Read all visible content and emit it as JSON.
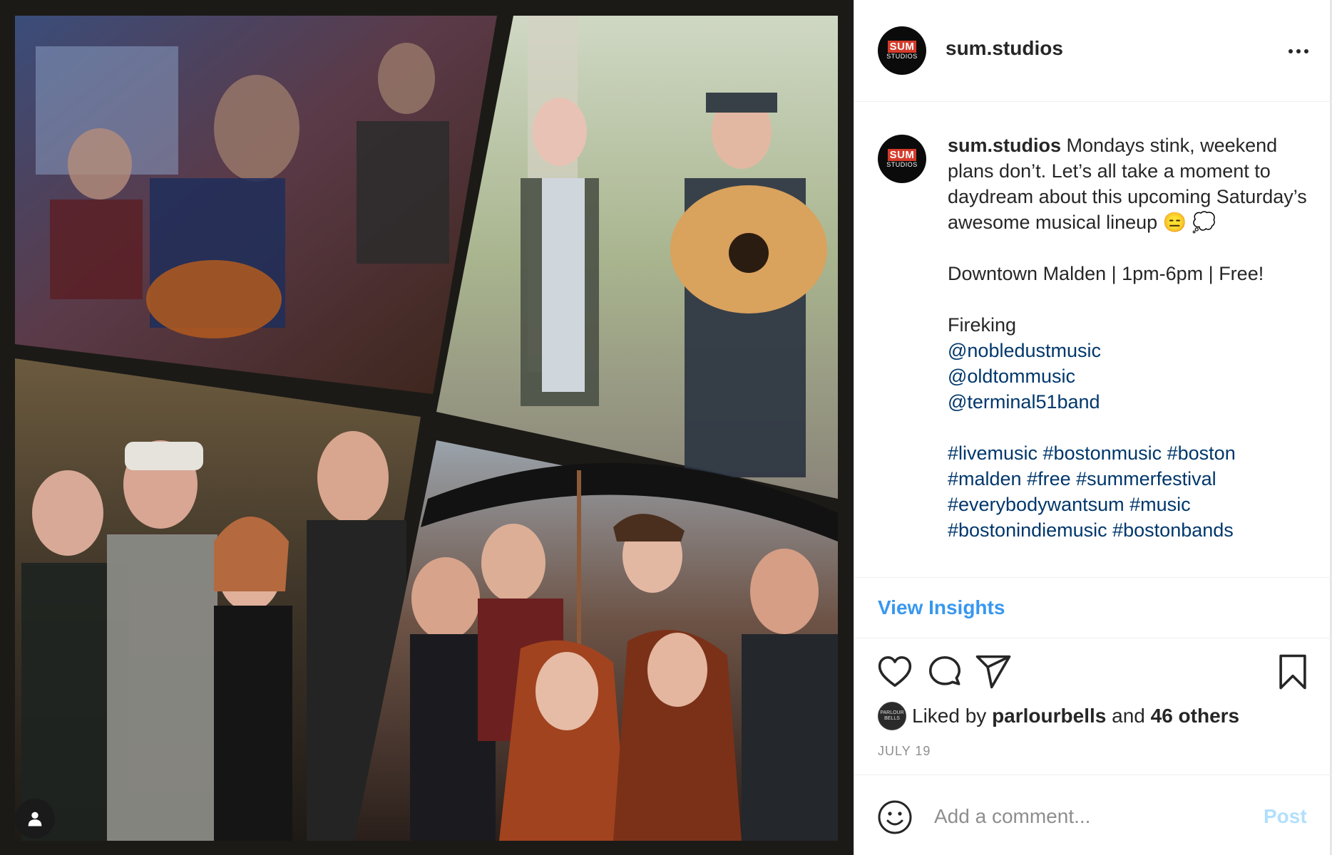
{
  "post": {
    "username": "sum.studios",
    "avatar_logo_top": "SUM",
    "avatar_logo_bottom": "STUDIOS",
    "caption": {
      "username": "sum.studios",
      "lines": [
        "Mondays stink, weekend plans don’t. Let’s all take a moment to daydream about this upcoming Saturday’s awesome musical lineup 😑 💭"
      ],
      "event": "Downtown Malden | 1pm-6pm | Free!",
      "lineup_first": "Fireking",
      "mentions": [
        "@nobledustmusic",
        "@oldtommusic",
        "@terminal51band"
      ],
      "hashtag_lines": [
        "#livemusic #bostonmusic #boston",
        "#malden #free #summerfestival",
        "#everybodywantsum #music",
        "#bostonindiemusic #bostonbands"
      ]
    },
    "insights_label": "View Insights",
    "likes": {
      "prefix": "Liked by",
      "liker": "parlourbells",
      "middle": "and",
      "others": "46 others",
      "liker_avatar_text": "PARLOUR BELLS"
    },
    "date": "JULY 19",
    "comment": {
      "placeholder": "Add a comment...",
      "post_label": "Post"
    },
    "colors": {
      "link": "#00376b",
      "insights": "#3897f0",
      "post_button_disabled": "#b2dffc",
      "media_background": "#1c1a17"
    },
    "icons": [
      "more-options-icon",
      "heart-icon",
      "comment-icon",
      "share-icon",
      "bookmark-icon",
      "emoji-icon",
      "tagged-user-icon"
    ]
  }
}
